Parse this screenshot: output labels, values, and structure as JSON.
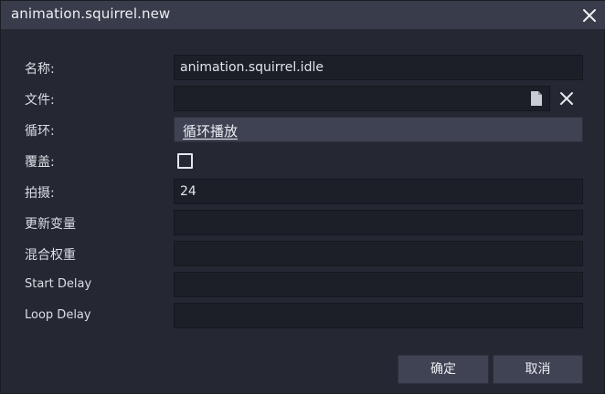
{
  "window": {
    "title": "animation.squirrel.new",
    "close_icon": "close-icon"
  },
  "form": {
    "name": {
      "label": "名称:",
      "value": "animation.squirrel.idle"
    },
    "file": {
      "label": "文件:",
      "value": "",
      "file_icon": "document-icon",
      "clear_icon": "close-icon"
    },
    "loop": {
      "label": "循环:",
      "selected": "循环播放"
    },
    "override": {
      "label": "覆盖:",
      "checked": false
    },
    "frames": {
      "label": "拍摄:",
      "value": "24"
    },
    "update_variables": {
      "label": "更新变量",
      "value": ""
    },
    "blend_weight": {
      "label": "混合权重",
      "value": ""
    },
    "start_delay": {
      "label": "Start Delay",
      "value": ""
    },
    "loop_delay": {
      "label": "Loop Delay",
      "value": ""
    }
  },
  "buttons": {
    "ok_label": "确定",
    "cancel_label": "取消"
  },
  "colors": {
    "background": "#252833",
    "titlebar": "#383c4b",
    "field": "#1c1f28",
    "button": "#3f4354"
  }
}
